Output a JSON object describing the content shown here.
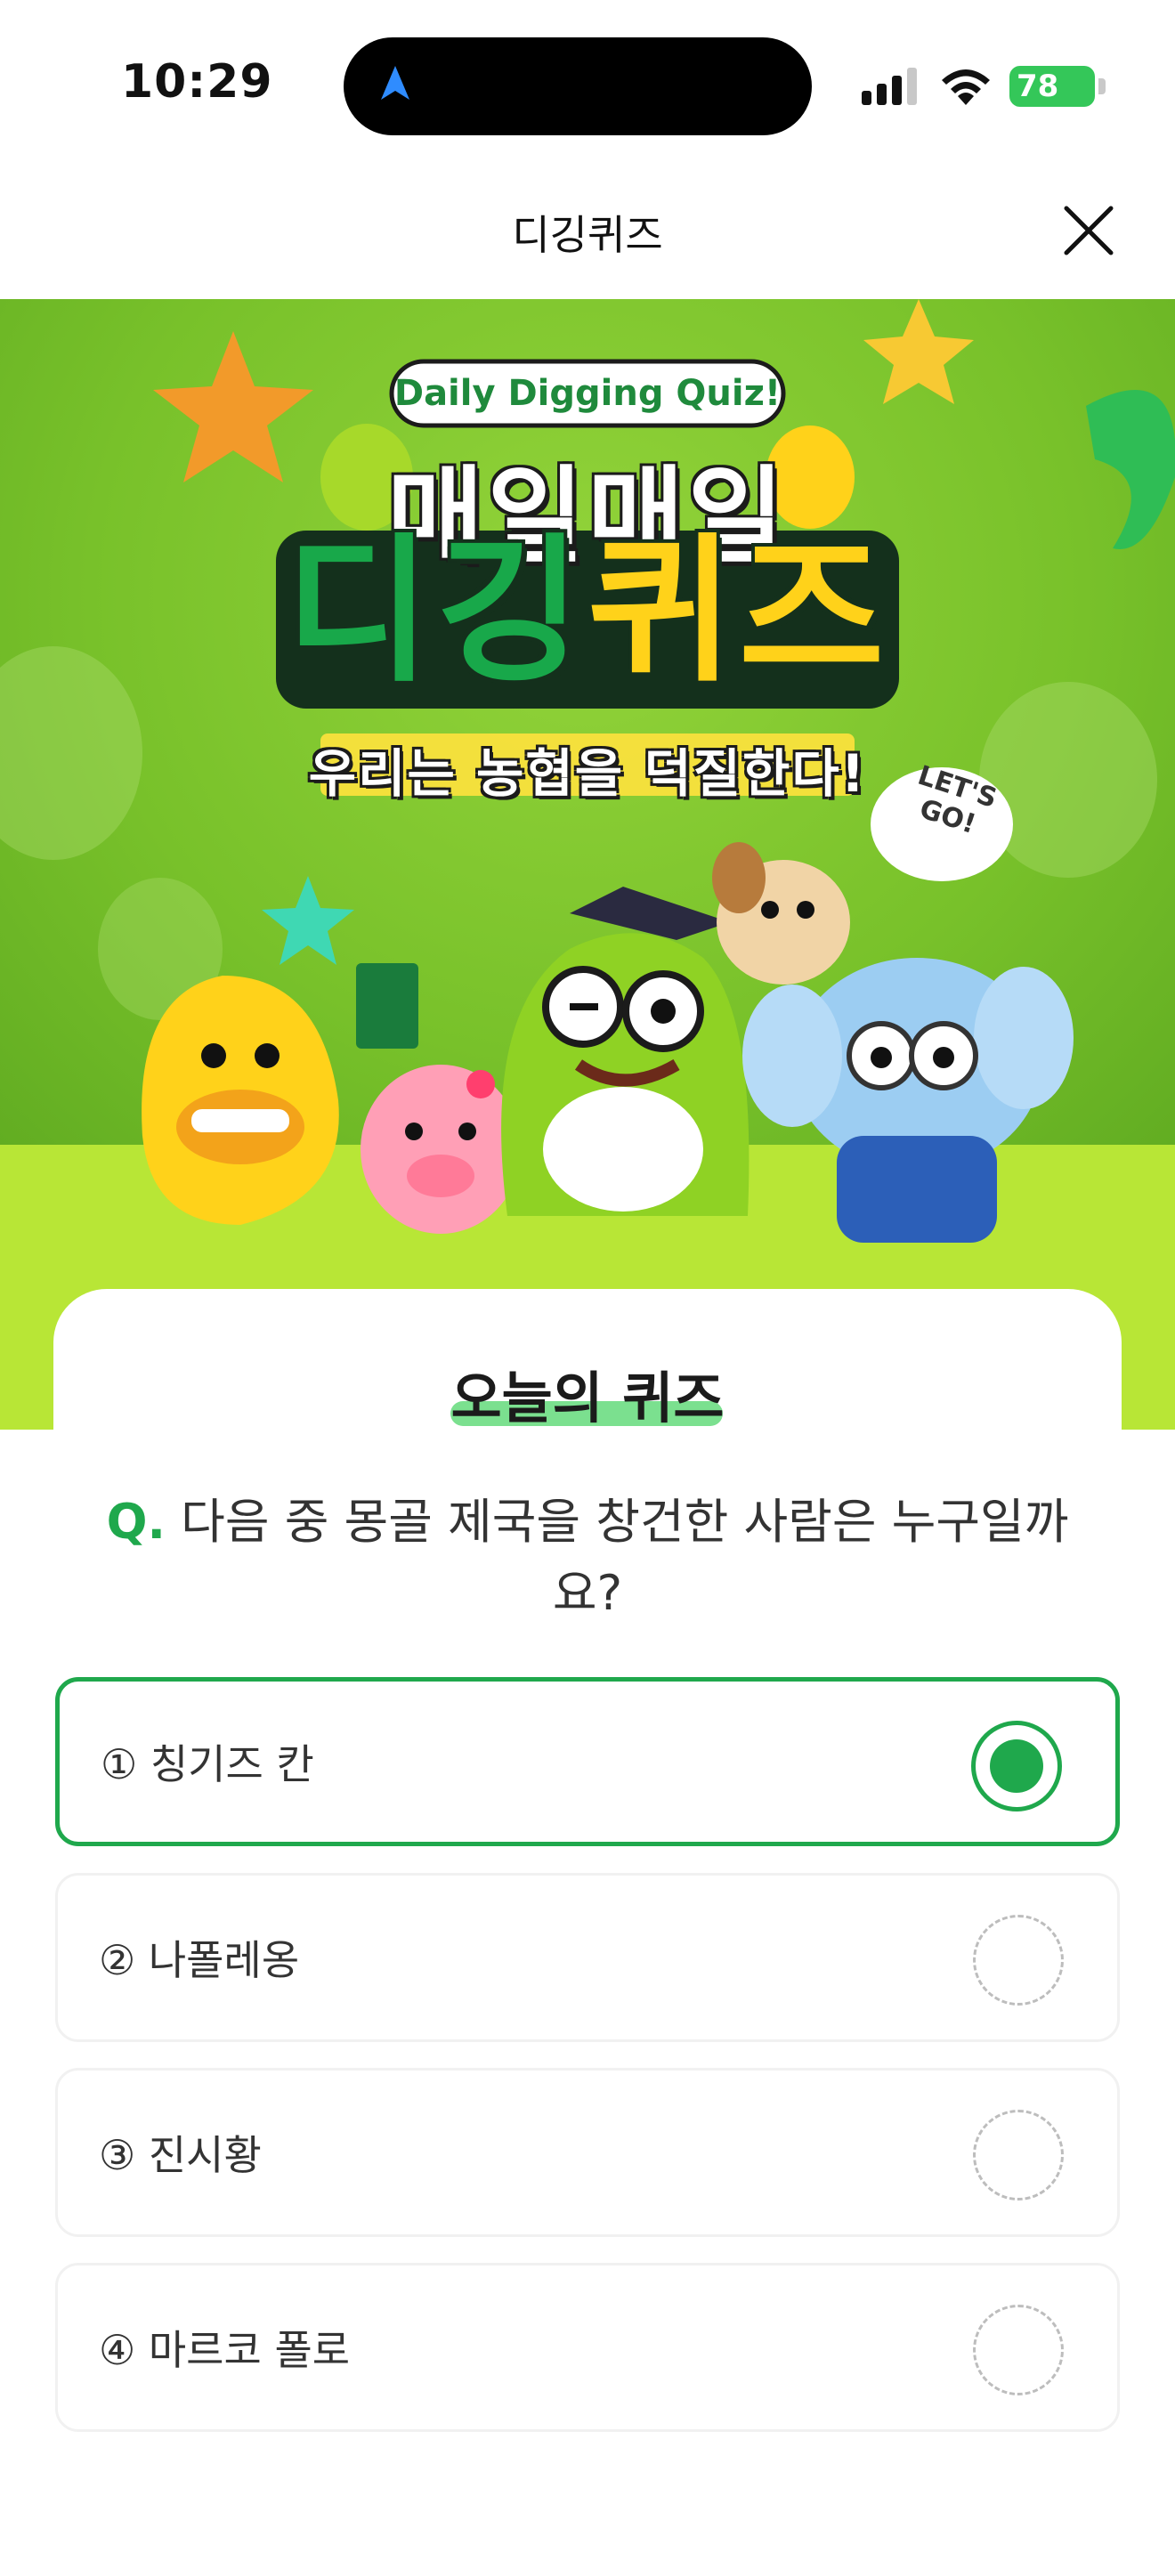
{
  "status_bar": {
    "time": "10:29",
    "battery": "78"
  },
  "header": {
    "title": "디깅퀴즈"
  },
  "hero": {
    "banner_en": "Daily Digging Quiz!",
    "title_line1": "매일매일",
    "title_line2_green": "디깅",
    "title_line2_yellow": "퀴즈",
    "slogan": "우리는 농협을 덕질한다!",
    "bubble": "LET'S GO!"
  },
  "card": {
    "title": "오늘의 퀴즈"
  },
  "quiz": {
    "q_prefix": "Q.",
    "question": "다음 중 몽골 제국을 창건한 사람은 누구일까요?",
    "options": [
      {
        "label": "① 칭기즈 칸",
        "selected": true
      },
      {
        "label": "② 나폴레옹",
        "selected": false
      },
      {
        "label": "③ 진시황",
        "selected": false
      },
      {
        "label": "④ 마르코 폴로",
        "selected": false
      }
    ]
  },
  "colors": {
    "brand_green": "#1fa84c",
    "hero_green": "#7ec82f",
    "accent_yellow": "#ffd21a"
  }
}
